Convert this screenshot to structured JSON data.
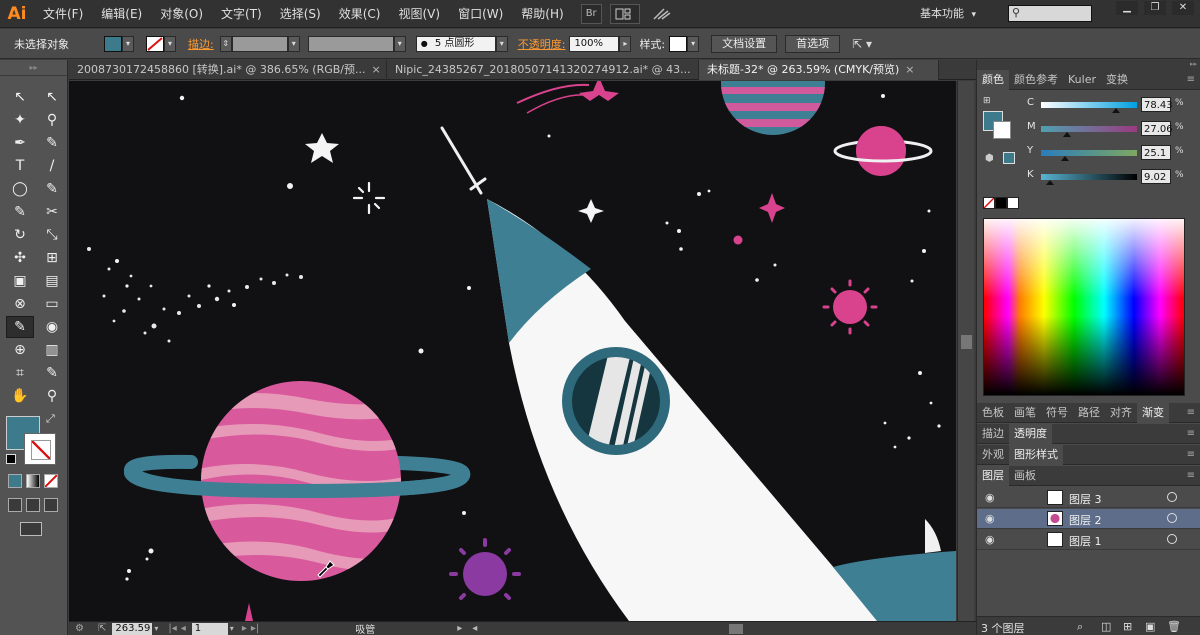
{
  "app": {
    "logo": "Ai"
  },
  "menu": [
    "文件(F)",
    "编辑(E)",
    "对象(O)",
    "文字(T)",
    "选择(S)",
    "效果(C)",
    "视图(V)",
    "窗口(W)",
    "帮助(H)"
  ],
  "menubar": {
    "bridge_label": "Br",
    "workspace": "基本功能",
    "workspace_arrow": "▾",
    "search_placeholder": ""
  },
  "control_bar": {
    "selection_status": "未选择对象",
    "stroke_label": "描边:",
    "brush_value": "5 点圆形",
    "opacity_label": "不透明度:",
    "opacity_value": "100%",
    "style_label": "样式:",
    "doc_setup": "文档设置",
    "preferences": "首选项",
    "fill_color": "#3d7a8c"
  },
  "tabs": [
    {
      "label": "20087301724588​60 [转换].ai* @ 386.65% (RGB/预...",
      "active": false
    },
    {
      "label": "Nipic_24385267_20180507141320274912.ai* @ 43...",
      "active": false
    },
    {
      "label": "未标题-32* @ 263.59% (CMYK/预览)",
      "active": true
    }
  ],
  "close_glyph": "×",
  "color_panel": {
    "tabs": [
      "颜色",
      "颜色参考",
      "Kuler",
      "变换"
    ],
    "active_tab": "颜色",
    "channels": [
      {
        "name": "C",
        "value": "78.43",
        "position": 0.78,
        "gradient": "linear-gradient(to right, #fff, #00a0e0)"
      },
      {
        "name": "M",
        "value": "27.06",
        "position": 0.27,
        "gradient": "linear-gradient(to right, #4fa0b0, #9a3a80)"
      },
      {
        "name": "Y",
        "value": "25.1",
        "position": 0.25,
        "gradient": "linear-gradient(to right, #2a7dbd, #7ea860)"
      },
      {
        "name": "K",
        "value": "9.02",
        "position": 0.09,
        "gradient": "linear-gradient(to right, #57b4d3, #000)"
      }
    ],
    "percent": "%"
  },
  "panel_group2": {
    "tabs": [
      "色板",
      "画笔",
      "符号",
      "路径",
      "对齐",
      "渐变"
    ],
    "active_tab": "渐变"
  },
  "panel_group3": {
    "tabs": [
      "描边",
      "透明度"
    ],
    "active_tab": "透明度"
  },
  "panel_group4": {
    "tabs": [
      "外观",
      "图形样式"
    ],
    "active_tab": "图形样式"
  },
  "panel_group5": {
    "tabs": [
      "图层",
      "画板"
    ],
    "active_tab": "图层"
  },
  "layers": [
    {
      "name": "图层 3",
      "selected": false
    },
    {
      "name": "图层 2",
      "selected": true
    },
    {
      "name": "图层 1",
      "selected": false
    }
  ],
  "layers_footer": {
    "count": "3 个图层"
  },
  "statusbar": {
    "zoom": "263.59",
    "artboard": "1",
    "tool": "吸管"
  },
  "toolbox": {
    "tools": [
      "↖",
      "↖",
      "✦",
      "⚲",
      "✒",
      "✎",
      "T",
      "/",
      "◯",
      "✎",
      "✎",
      "✂",
      "↻",
      "⤡",
      "✣",
      "⊞",
      "▣",
      "▤",
      "⊗",
      "▭",
      "✎",
      "◉",
      "⊕",
      "▥",
      "⌗",
      "✎",
      "✋",
      "⚲"
    ]
  }
}
